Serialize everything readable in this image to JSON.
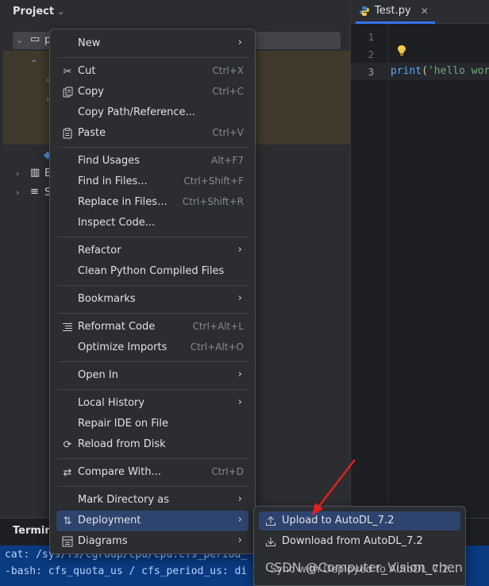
{
  "project_panel": {
    "title": "Project",
    "tree": [
      {
        "label": "p",
        "expanded": true
      },
      {
        "label": "",
        "expanded": true
      },
      {
        "label": "E"
      },
      {
        "label": "S"
      }
    ]
  },
  "editor": {
    "tab_label": "Test.py",
    "line_numbers": [
      "1",
      "2",
      "3"
    ],
    "code": {
      "fn": "print",
      "open": "(",
      "str": "'hello wor"
    }
  },
  "terminal": {
    "title": "Termina",
    "lines": [
      "cat: /sys/fs/cgroup/cpu/cpu.cfs_period_",
      "-bash: cfs_quota_us / cfs_period_us: di"
    ]
  },
  "context_menu": {
    "items": [
      {
        "icon": "",
        "label": "New",
        "shortcut": "",
        "submenu": true
      },
      {
        "icon": "scissors-icon",
        "label": "Cut",
        "shortcut": "Ctrl+X"
      },
      {
        "icon": "copy-icon",
        "label": "Copy",
        "shortcut": "Ctrl+C"
      },
      {
        "icon": "",
        "label": "Copy Path/Reference...",
        "shortcut": ""
      },
      {
        "icon": "paste-icon",
        "label": "Paste",
        "shortcut": "Ctrl+V"
      },
      {
        "icon": "",
        "label": "Find Usages",
        "shortcut": "Alt+F7"
      },
      {
        "icon": "",
        "label": "Find in Files...",
        "shortcut": "Ctrl+Shift+F"
      },
      {
        "icon": "",
        "label": "Replace in Files...",
        "shortcut": "Ctrl+Shift+R"
      },
      {
        "icon": "",
        "label": "Inspect Code...",
        "shortcut": ""
      },
      {
        "icon": "",
        "label": "Refactor",
        "shortcut": "",
        "submenu": true
      },
      {
        "icon": "",
        "label": "Clean Python Compiled Files",
        "shortcut": ""
      },
      {
        "icon": "",
        "label": "Bookmarks",
        "shortcut": "",
        "submenu": true
      },
      {
        "icon": "reformat-icon",
        "label": "Reformat Code",
        "shortcut": "Ctrl+Alt+L"
      },
      {
        "icon": "",
        "label": "Optimize Imports",
        "shortcut": "Ctrl+Alt+O"
      },
      {
        "icon": "",
        "label": "Open In",
        "shortcut": "",
        "submenu": true
      },
      {
        "icon": "",
        "label": "Local History",
        "shortcut": "",
        "submenu": true
      },
      {
        "icon": "",
        "label": "Repair IDE on File",
        "shortcut": ""
      },
      {
        "icon": "reload-icon",
        "label": "Reload from Disk",
        "shortcut": ""
      },
      {
        "icon": "compare-icon",
        "label": "Compare With...",
        "shortcut": "Ctrl+D"
      },
      {
        "icon": "",
        "label": "Mark Directory as",
        "shortcut": "",
        "submenu": true
      },
      {
        "icon": "deployment-icon",
        "label": "Deployment",
        "shortcut": "",
        "submenu": true
      },
      {
        "icon": "diagrams-icon",
        "label": "Diagrams",
        "shortcut": "",
        "submenu": true
      }
    ]
  },
  "submenu": {
    "items": [
      {
        "icon": "upload-icon",
        "label": "Upload to AutoDL_7.2"
      },
      {
        "icon": "download-icon",
        "label": "Download from AutoDL_7.2"
      },
      {
        "icon": "",
        "label": "Sync with Deployed to AutoDL_7.2..."
      }
    ]
  },
  "watermark": "CSDN @Computer_Vision_chen",
  "colors": {
    "accent": "#3574f0",
    "selection": "#2e436e",
    "arrow": "#e02020"
  }
}
